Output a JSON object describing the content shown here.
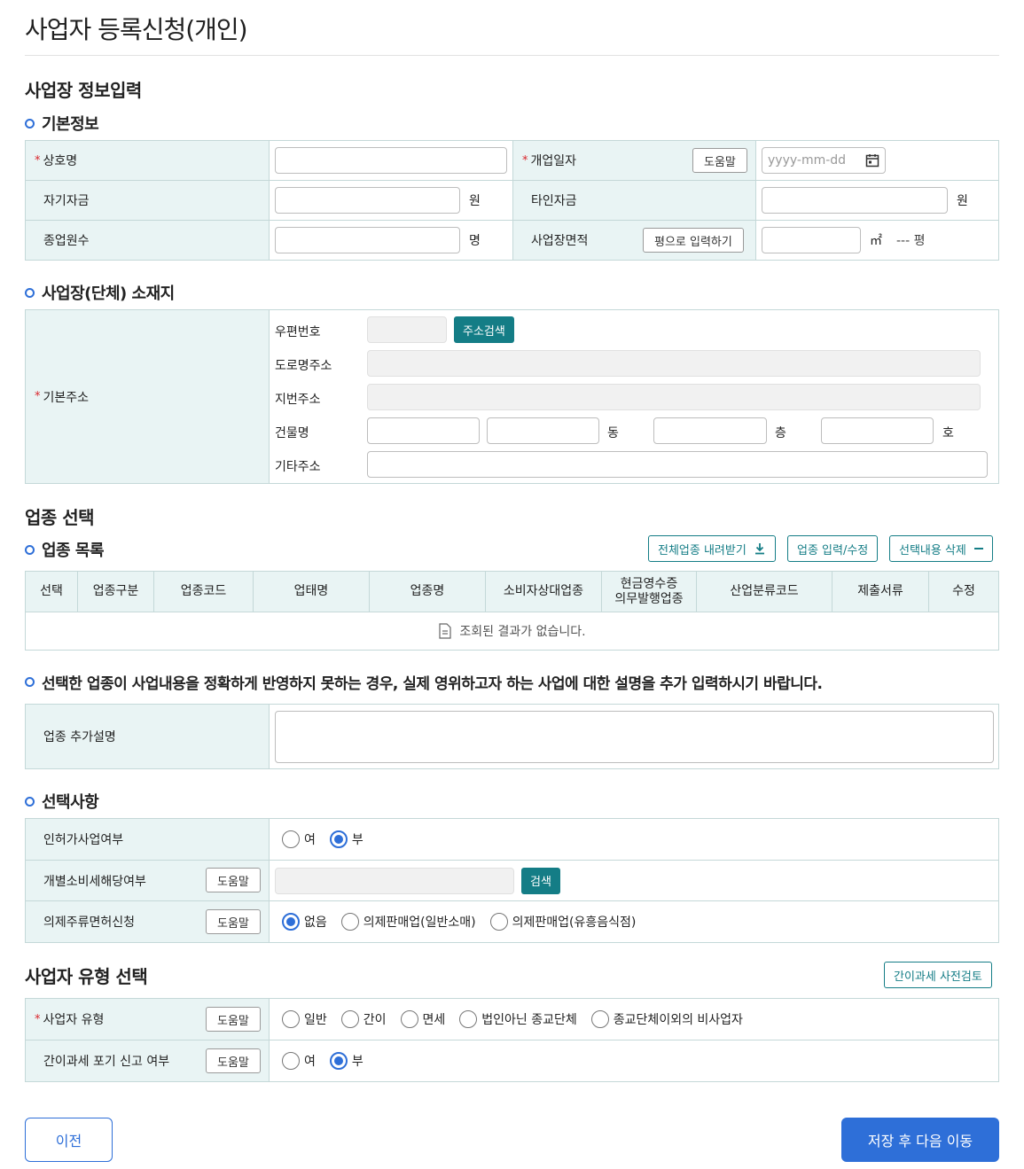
{
  "page_title": "사업자 등록신청(개인)",
  "section_business_info": "사업장 정보입력",
  "basic_info": {
    "heading": "기본정보",
    "trade_name_label": "상호명",
    "trade_name_value": "",
    "open_date_label": "개업일자",
    "help_label": "도움말",
    "open_date_placeholder": "yyyy-mm-dd",
    "own_fund_label": "자기자금",
    "own_fund_value": "",
    "won": "원",
    "other_fund_label": "타인자금",
    "other_fund_value": "",
    "employees_label": "종업원수",
    "employees_value": "",
    "person_unit": "명",
    "area_label": "사업장면적",
    "pyeong_button": "평으로 입력하기",
    "area_value": "",
    "sqm_unit": "㎡",
    "pyeong_display": "--- 평"
  },
  "address": {
    "heading": "사업장(단체) 소재지",
    "base_label": "기본주소",
    "zip_label": "우편번호",
    "search_button": "주소검색",
    "road_label": "도로명주소",
    "lot_label": "지번주소",
    "building_label": "건물명",
    "dong_unit": "동",
    "floor_unit": "층",
    "ho_unit": "호",
    "etc_label": "기타주소"
  },
  "industry": {
    "section_title": "업종 선택",
    "list_heading": "업종 목록",
    "download_button": "전체업종 내려받기",
    "edit_button": "업종 입력/수정",
    "delete_button": "선택내용 삭제",
    "columns": [
      "선택",
      "업종구분",
      "업종코드",
      "업태명",
      "업종명",
      "소비자상대업종",
      "현금영수증\n의무발행업종",
      "산업분류코드",
      "제출서류",
      "수정"
    ],
    "empty_message": "조회된 결과가 없습니다.",
    "notice": "선택한 업종이 사업내용을 정확하게 반영하지 못하는 경우, 실제 영위하고자 하는 사업에 대한 설명을 추가 입력하시기 바랍니다.",
    "extra_desc_label": "업종 추가설명",
    "extra_desc_value": ""
  },
  "options": {
    "heading": "선택사항",
    "license_label": "인허가사업여부",
    "yes": "여",
    "no": "부",
    "excise_label": "개별소비세해당여부",
    "help_label": "도움말",
    "search_button": "검색",
    "liquor_label": "의제주류면허신청",
    "liquor_none": "없음",
    "liquor_retail": "의제판매업(일반소매)",
    "liquor_bar": "의제판매업(유흥음식점)"
  },
  "biz_type": {
    "section_title": "사업자 유형 선택",
    "review_button": "간이과세 사전검토",
    "type_label": "사업자 유형",
    "help_label": "도움말",
    "general": "일반",
    "simple": "간이",
    "exempt": "면세",
    "religious": "법인아닌 종교단체",
    "non_business": "종교단체이외의 비사업자",
    "giveup_label": "간이과세 포기 신고 여부",
    "yes": "여",
    "no": "부"
  },
  "footer": {
    "prev_button": "이전",
    "next_button": "저장 후 다음 이동"
  },
  "colors": {
    "accent_blue": "#2e6fd8",
    "teal": "#147d86",
    "header_bg": "#e9f4f4",
    "required_red": "#d9262c"
  }
}
